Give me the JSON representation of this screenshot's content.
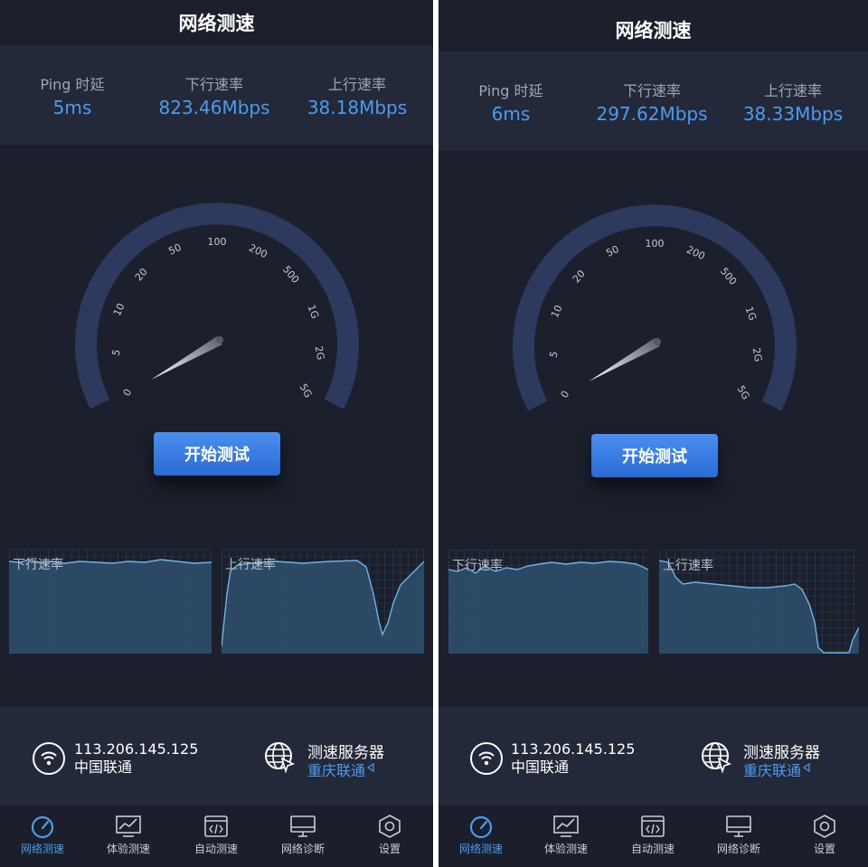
{
  "screens": [
    {
      "title": "网络测速",
      "stats": [
        {
          "label": "Ping 时延",
          "value": "5ms"
        },
        {
          "label": "下行速率",
          "value": "823.46Mbps"
        },
        {
          "label": "上行速率",
          "value": "38.18Mbps"
        }
      ],
      "gauge_ticks": [
        "0",
        "5",
        "10",
        "20",
        "50",
        "100",
        "200",
        "500",
        "1G",
        "2G",
        "5G"
      ],
      "start_button": "开始测试",
      "download_chart_label": "下行速率",
      "upload_chart_label": "上行速率",
      "ip": "113.206.145.125",
      "isp": "中国联通",
      "server_title": "测速服务器",
      "server_name": "重庆联通",
      "tabs": [
        "网络测速",
        "体验测速",
        "自动测速",
        "网络诊断",
        "设置"
      ],
      "active_tab": "网络测速"
    },
    {
      "title": "网络测速",
      "stats": [
        {
          "label": "Ping 时延",
          "value": "6ms"
        },
        {
          "label": "下行速率",
          "value": "297.62Mbps"
        },
        {
          "label": "上行速率",
          "value": "38.33Mbps"
        }
      ],
      "gauge_ticks": [
        "0",
        "5",
        "10",
        "20",
        "50",
        "100",
        "200",
        "500",
        "1G",
        "2G",
        "5G"
      ],
      "start_button": "开始测试",
      "download_chart_label": "下行速率",
      "upload_chart_label": "上行速率",
      "ip": "113.206.145.125",
      "isp": "中国联通",
      "server_title": "测速服务器",
      "server_name": "重庆联通",
      "tabs": [
        "网络测速",
        "体验测速",
        "自动测速",
        "网络诊断",
        "设置"
      ],
      "active_tab": "网络测速"
    }
  ],
  "colors": {
    "background": "#1b202c",
    "panel": "#232938",
    "accent": "#4c9bf0",
    "gauge_track": "#2d3a5e",
    "chart_fill": "#2e4e6a"
  },
  "icons": [
    "speedometer-icon",
    "chart-icon",
    "code-icon",
    "monitor-icon",
    "hexagon-settings-icon",
    "wifi-icon",
    "globe-cursor-icon",
    "triangle-indicator-icon"
  ]
}
